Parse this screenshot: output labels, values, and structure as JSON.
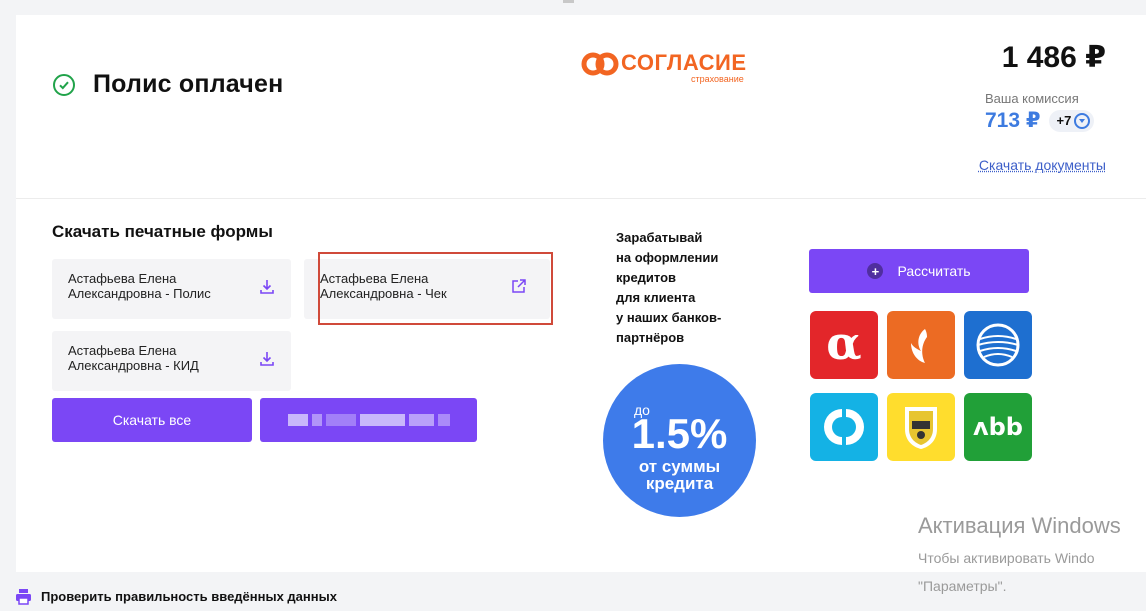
{
  "header": {
    "status_title": "Полис оплачен",
    "logo_text": "СОГЛАСИЕ",
    "logo_sub": "страхование",
    "price": "1 486 ₽",
    "commission_label": "Ваша комиссия",
    "commission_value": "713 ₽",
    "commission_badge": "+7",
    "docs_link": "Скачать документы"
  },
  "forms": {
    "title": "Скачать печатные формы",
    "tiles": [
      {
        "line1": "Астафьева Елена",
        "line2": "Александровна - Полис",
        "icon": "download-icon"
      },
      {
        "line1": "Астафьева Елена",
        "line2": "Александровна - Чек",
        "icon": "external-link-icon"
      },
      {
        "line1": "Астафьева Елена",
        "line2": "Александровна - КИД",
        "icon": "download-icon"
      }
    ],
    "download_all": "Скачать все"
  },
  "promo": {
    "lines": [
      "Зарабатывай",
      "на оформлении",
      "кредитов",
      "для клиента",
      "у наших банков-",
      "партнёров"
    ],
    "circle_pre": "до",
    "circle_big": "1.5%",
    "circle_sub1": "от суммы",
    "circle_sub2": "кредита",
    "calc_button": "Рассчитать"
  },
  "banks": [
    "alfa-bank-logo",
    "ural-bank-logo",
    "gazprombank-logo",
    "otkritie-logo",
    "tinkoff-logo",
    "rosselkhozbank-logo"
  ],
  "watermark": {
    "title": "Активация Windows",
    "line1": "Чтобы активировать Windo",
    "line2": "\"Параметры\"."
  },
  "footer": {
    "text": "Проверить правильность введённых данных"
  },
  "colors": {
    "accent": "#7b47f5",
    "success": "#21a34a",
    "link": "#3d5fc9",
    "promo": "#3e7bea",
    "brand": "#f26522"
  }
}
